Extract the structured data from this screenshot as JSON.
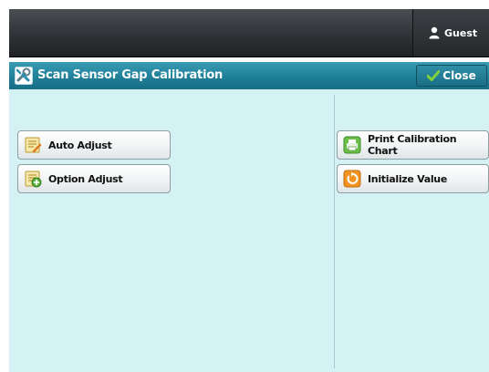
{
  "topbar": {
    "user": {
      "label": "Guest",
      "icon": "user-icon"
    }
  },
  "titlebar": {
    "title": "Scan Sensor Gap Calibration",
    "icon": "tools-icon",
    "close_label": "Close"
  },
  "left_buttons": [
    {
      "label": "Auto Adjust",
      "icon": "auto-adjust-icon"
    },
    {
      "label": "Option Adjust",
      "icon": "option-adjust-icon"
    }
  ],
  "right_buttons": [
    {
      "label": "Print Calibration Chart",
      "icon": "printer-icon"
    },
    {
      "label": "Initialize Value",
      "icon": "reset-icon"
    }
  ],
  "colors": {
    "titlebar": "#1f7f98",
    "content_bg": "#d4f1f3",
    "topbar": "#2f3236",
    "check_green": "#7fd13b",
    "reset_orange": "#f39422"
  }
}
